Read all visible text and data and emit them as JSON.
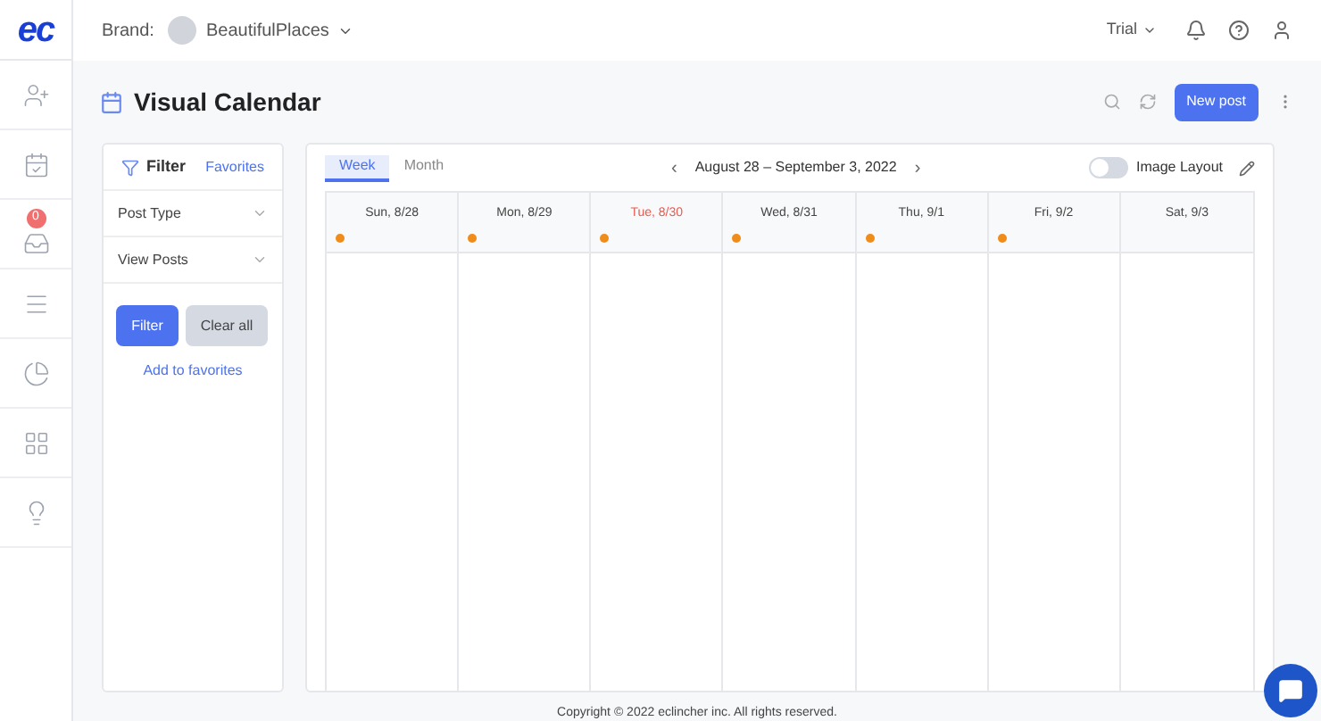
{
  "logo": "ec",
  "header": {
    "brand_label": "Brand:",
    "brand_name": "BeautifulPlaces",
    "plan": "Trial"
  },
  "sidebar": {
    "inbox_badge": "0"
  },
  "page": {
    "title": "Visual Calendar",
    "new_post": "New post"
  },
  "filter": {
    "title": "Filter",
    "favorites": "Favorites",
    "sections": [
      "Post Type",
      "View Posts"
    ],
    "filter_button": "Filter",
    "clear_button": "Clear all",
    "add_favorites": "Add to favorites"
  },
  "calendar": {
    "tabs": [
      {
        "label": "Week",
        "selected": true
      },
      {
        "label": "Month",
        "selected": false
      }
    ],
    "prev": "‹",
    "range": "August 28 – September 3, 2022",
    "next": "›",
    "image_layout": {
      "label": "Image Layout",
      "on": false
    },
    "days": [
      {
        "label": "Sun, 8/28",
        "today": false,
        "has_post": true
      },
      {
        "label": "Mon, 8/29",
        "today": false,
        "has_post": true
      },
      {
        "label": "Tue, 8/30",
        "today": true,
        "has_post": true
      },
      {
        "label": "Wed, 8/31",
        "today": false,
        "has_post": true
      },
      {
        "label": "Thu, 9/1",
        "today": false,
        "has_post": true
      },
      {
        "label": "Fri, 9/2",
        "today": false,
        "has_post": true
      },
      {
        "label": "Sat, 9/3",
        "today": false,
        "has_post": false
      }
    ]
  },
  "footer": {
    "copyright": "Copyright © 2022 eclincher inc. All rights reserved."
  }
}
